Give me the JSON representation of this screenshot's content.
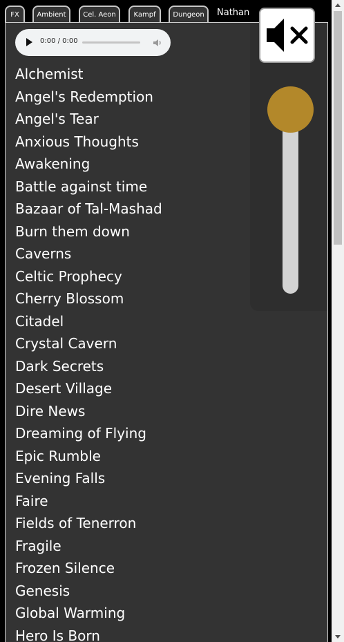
{
  "tabs": [
    {
      "label": "FX"
    },
    {
      "label": "Ambient"
    },
    {
      "label": "Cel. Aeon"
    },
    {
      "label": "Kampf"
    },
    {
      "label": "Dungeon"
    },
    {
      "label": "Nathan"
    }
  ],
  "audio": {
    "time": "0:00 / 0:00",
    "progress": 0
  },
  "volume": {
    "level": 1.0,
    "muted": true
  },
  "tracks": [
    "Alchemist",
    "Angel's Redemption",
    "Angel's Tear",
    "Anxious Thoughts",
    "Awakening",
    "Battle against time",
    "Bazaar of Tal-Mashad",
    "Burn them down",
    "Caverns",
    "Celtic Prophecy",
    "Cherry Blossom",
    "Citadel",
    "Crystal Cavern",
    "Dark Secrets",
    "Desert Village",
    "Dire News",
    "Dreaming of Flying",
    "Epic Rumble",
    "Evening Falls",
    "Faire",
    "Fields of Tenerron",
    "Fragile",
    "Frozen Silence",
    "Genesis",
    "Global Warming",
    "Hero Is Born"
  ],
  "colors": {
    "panel": "#333333",
    "accent": "#b3882a",
    "slider_track": "#d3d3d3"
  },
  "icons": {
    "play": "play-icon",
    "speaker": "speaker-icon",
    "mute": "speaker-mute-icon"
  }
}
